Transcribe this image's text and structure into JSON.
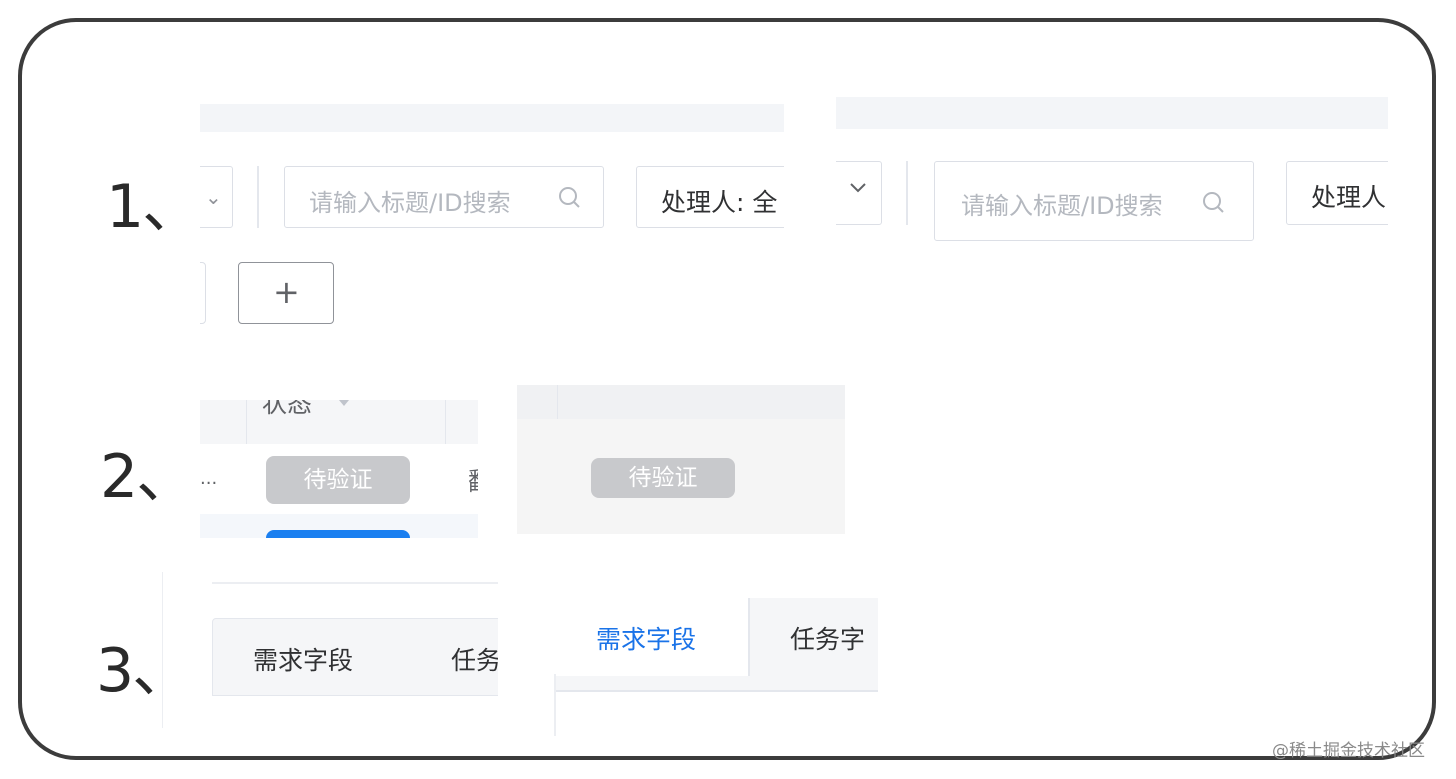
{
  "steps": {
    "one": "1、",
    "two": "2、",
    "three": "3、"
  },
  "row1": {
    "left": {
      "search_placeholder": "请输入标题/ID搜索",
      "assignee_label": "处理人: 全",
      "add_label": "+"
    },
    "right": {
      "search_placeholder": "请输入标题/ID搜索",
      "assignee_label": "处理人"
    }
  },
  "row2": {
    "left": {
      "column_header": "状态",
      "cell_ellipsis": "...",
      "status_badge": "待验证",
      "next_column_fragment": "翻"
    },
    "right": {
      "status_badge": "待验证"
    }
  },
  "row3": {
    "left": {
      "tabs": [
        "需求字段",
        "任务"
      ]
    },
    "right": {
      "tabs": [
        "需求字段",
        "任务字"
      ],
      "active_color": "#1a73e8"
    }
  },
  "watermark": "@稀土掘金技术社区"
}
